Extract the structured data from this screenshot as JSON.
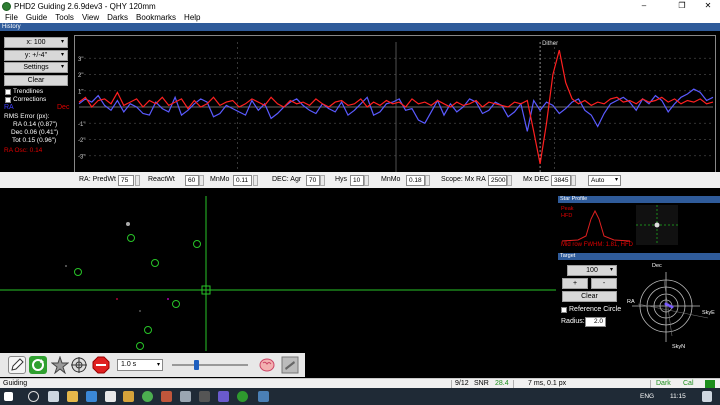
{
  "window": {
    "title": "PHD2 Guiding 2.6.9dev3 - QHY 120mm",
    "controls": [
      "–",
      "❐",
      "✕"
    ]
  },
  "menu": [
    "File",
    "Guide",
    "Tools",
    "View",
    "Darks",
    "Bookmarks",
    "Help"
  ],
  "history": {
    "panel_title": "History",
    "x_scale": "x: 100",
    "y_scale": "y: +/-4\"",
    "settings": "Settings",
    "clear": "Clear",
    "trendlines": "Trendlines",
    "corrections": "Corrections",
    "ra_label": "RA",
    "dec_label": "Dec",
    "rms_title": "RMS Error (px):",
    "rms_ra": "RA 0.14 (0.87\")",
    "rms_dec": "Dec 0.06 (0.41\")",
    "rms_tot": "Tot 0.15 (0.96\")",
    "ra_dec_ratio": "RA Osc: 0.14",
    "y_ticks": [
      "3\"",
      "2\"",
      "1\"",
      "-1\"",
      "-2\"",
      "-3\""
    ],
    "dither_label": "Dither",
    "colors": {
      "ra": "#5a5aff",
      "dec": "#ff2020"
    }
  },
  "chart_data": {
    "type": "line",
    "title": "",
    "xlabel": "",
    "ylabel": "",
    "ylim": [
      -4,
      4
    ],
    "x": [
      0,
      1,
      2,
      3,
      4,
      5,
      6,
      7,
      8,
      9,
      10,
      11,
      12,
      13,
      14,
      15,
      16,
      17,
      18,
      19,
      20,
      21,
      22,
      23,
      24,
      25,
      26,
      27,
      28,
      29,
      30,
      31,
      32,
      33,
      34,
      35,
      36,
      37,
      38,
      39,
      40,
      41,
      42,
      43,
      44,
      45,
      46,
      47,
      48,
      49,
      50,
      51,
      52,
      53,
      54,
      55,
      56,
      57,
      58,
      59,
      60,
      61,
      62,
      63,
      64,
      65,
      66,
      67,
      68,
      69,
      70,
      71,
      72,
      73,
      74,
      75,
      76,
      77,
      78,
      79,
      80,
      81,
      82,
      83,
      84,
      85,
      86,
      87,
      88,
      89,
      90,
      91,
      92,
      93,
      94,
      95,
      96,
      97,
      98,
      99
    ],
    "series": [
      {
        "name": "RA",
        "color": "#5a5aff",
        "values": [
          0.2,
          0.5,
          0.3,
          0.7,
          0.1,
          -0.2,
          0.4,
          -0.3,
          0.2,
          0.0,
          -0.4,
          -0.5,
          0.3,
          -0.1,
          -0.3,
          0.6,
          -0.5,
          -0.2,
          0.2,
          0.5,
          0.3,
          -0.6,
          -0.4,
          0.1,
          -0.1,
          -0.3,
          -0.5,
          0.4,
          -0.2,
          0.2,
          -0.7,
          -0.4,
          0.0,
          0.3,
          0.5,
          0.1,
          -0.2,
          -0.4,
          0.2,
          -0.1,
          -0.3,
          0.3,
          -0.5,
          -0.2,
          0.2,
          0.6,
          -0.5,
          -0.3,
          0.2,
          0.3,
          0.5,
          -0.2,
          -0.1,
          -0.8,
          -1.0,
          -0.3,
          0.4,
          -0.5,
          0.2,
          -0.3,
          0.0,
          0.5,
          0.3,
          -0.4,
          -0.2,
          0.3,
          0.1,
          -0.6,
          -0.3,
          0.2,
          -1.5,
          0.4,
          -0.2,
          0.3,
          0.1,
          -0.4,
          -0.1,
          0.3,
          0.5,
          -0.2,
          -0.5,
          -1.2,
          -0.4,
          0.2,
          0.4,
          0.6,
          0.3,
          -0.2,
          0.5,
          0.2,
          0.7,
          0.4,
          -0.3,
          0.2,
          0.6,
          0.8,
          1.1,
          0.9,
          0.4,
          0.6
        ]
      },
      {
        "name": "Dec",
        "color": "#ff2020",
        "values": [
          0.3,
          0.6,
          0.0,
          0.4,
          0.5,
          0.2,
          0.9,
          0.1,
          0.3,
          0.5,
          0.0,
          0.4,
          0.2,
          0.6,
          0.1,
          0.3,
          0.5,
          -0.1,
          0.4,
          0.0,
          0.2,
          0.6,
          0.1,
          0.3,
          0.4,
          0.0,
          0.2,
          0.5,
          0.3,
          0.1,
          0.6,
          0.2,
          0.0,
          0.4,
          0.2,
          0.3,
          0.1,
          0.5,
          0.2,
          0.0,
          0.3,
          0.4,
          0.1,
          0.2,
          0.5,
          0.0,
          0.3,
          0.1,
          0.4,
          0.2,
          0.3,
          0.0,
          0.5,
          0.2,
          0.3,
          0.1,
          0.4,
          0.2,
          0.0,
          0.3,
          0.1,
          0.2,
          0.4,
          0.0,
          0.3,
          0.2,
          0.1,
          0.0,
          0.3,
          0.2,
          0.4,
          -1.5,
          -3.5,
          -1.0,
          2.0,
          3.5,
          1.5,
          0.5,
          0.2,
          0.4,
          0.1,
          0.3,
          0.2,
          0.5,
          0.6,
          0.3,
          0.4,
          0.2,
          0.5,
          0.3,
          0.4,
          0.6,
          0.3,
          0.5,
          0.2,
          0.4,
          0.3,
          0.5,
          0.2,
          0.3
        ]
      }
    ]
  },
  "params": {
    "ra_predwt_label": "RA: PredWt",
    "ra_predwt": "75",
    "ra_reactwt_label": "ReactWt",
    "ra_reactwt": "60",
    "ra_minmo_label": "MnMo",
    "ra_minmo": "0.11",
    "dec_agr_label": "DEC: Agr",
    "dec_agr": "70",
    "dec_hys_label": "Hys",
    "dec_hys": "10",
    "dec_minmo_label": "MnMo",
    "dec_minmo": "0.18",
    "scope_maxra_label": "Scope: Mx RA",
    "scope_maxra": "2500",
    "scope_maxdec_label": "Mx DEC",
    "scope_maxdec": "3845",
    "dec_mode": "Auto"
  },
  "star_profile": {
    "panel_title": "Star Profile",
    "peak_label": "Peak",
    "hfd_label": "HFD",
    "footer": "Mid row FWHM: 1.81, HFD"
  },
  "target": {
    "panel_title": "Target",
    "scale_value": "100",
    "plus": "+",
    "minus": "-",
    "clear": "Clear",
    "reference_circle": "Reference Circle",
    "radius_label": "Radius:",
    "radius_value": "2.0",
    "label_dec": "Dec",
    "label_ra": "RA",
    "label_skye": "SkyE",
    "label_skyn": "SkyN"
  },
  "toolbar": {
    "exposure": "1.0 s"
  },
  "status": {
    "state": "Guiding",
    "frame": "9/12",
    "snr_label": "SNR",
    "snr_value": "28.4",
    "exposure_info": "7 ms, 0.1 px",
    "dark": "Dark",
    "cal": "Cal"
  },
  "taskbar": {
    "time": "11:15",
    "lang": "ENG"
  }
}
